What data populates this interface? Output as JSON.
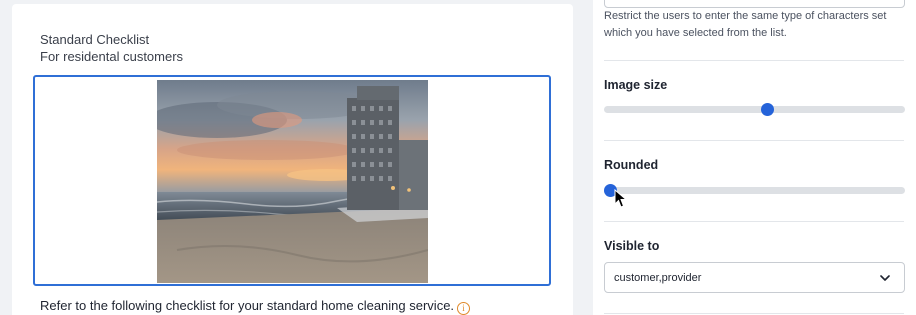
{
  "canvas": {
    "title": "Standard Checklist",
    "subtitle": "For residental customers",
    "image": {
      "scene": "sunset-beach-with-building"
    },
    "description": "Refer to the following checklist for your standard home cleaning service.",
    "info_icon_glyph": "i"
  },
  "props": {
    "restrict_help": "Restrict the users to enter the same type of characters set which you have selected from the list.",
    "image_size": {
      "label": "Image size",
      "value": 0.54
    },
    "rounded": {
      "label": "Rounded",
      "value": 0.02
    },
    "visible_to": {
      "label": "Visible to",
      "value": "customer,provider"
    }
  },
  "colors": {
    "accent": "#2563d9",
    "selection": "#2f6fd6",
    "info": "#e08a2b"
  }
}
